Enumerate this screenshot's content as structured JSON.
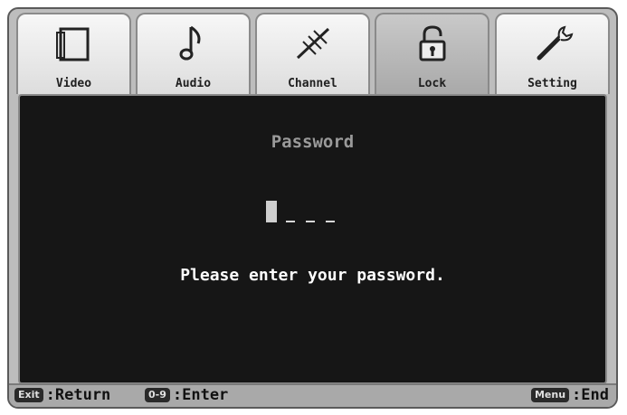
{
  "tabs": [
    {
      "label": "Video",
      "icon": "video-icon"
    },
    {
      "label": "Audio",
      "icon": "music-note-icon"
    },
    {
      "label": "Channel",
      "icon": "antenna-icon"
    },
    {
      "label": "Lock",
      "icon": "padlock-icon",
      "active": true
    },
    {
      "label": "Setting",
      "icon": "wrench-icon"
    }
  ],
  "lock_panel": {
    "title": "Password",
    "message": "Please enter your password.",
    "digits_entered": 0,
    "digits_total": 4
  },
  "footer": {
    "exit_key": "Exit",
    "exit_label": ":Return",
    "digits_key": "0-9",
    "digits_label": ":Enter",
    "menu_key": "Menu",
    "menu_label": ":End"
  },
  "colors": {
    "panel_bg": "#161616",
    "frame_bg": "#bdbdbd",
    "active_tab": "#b0b0b0"
  }
}
